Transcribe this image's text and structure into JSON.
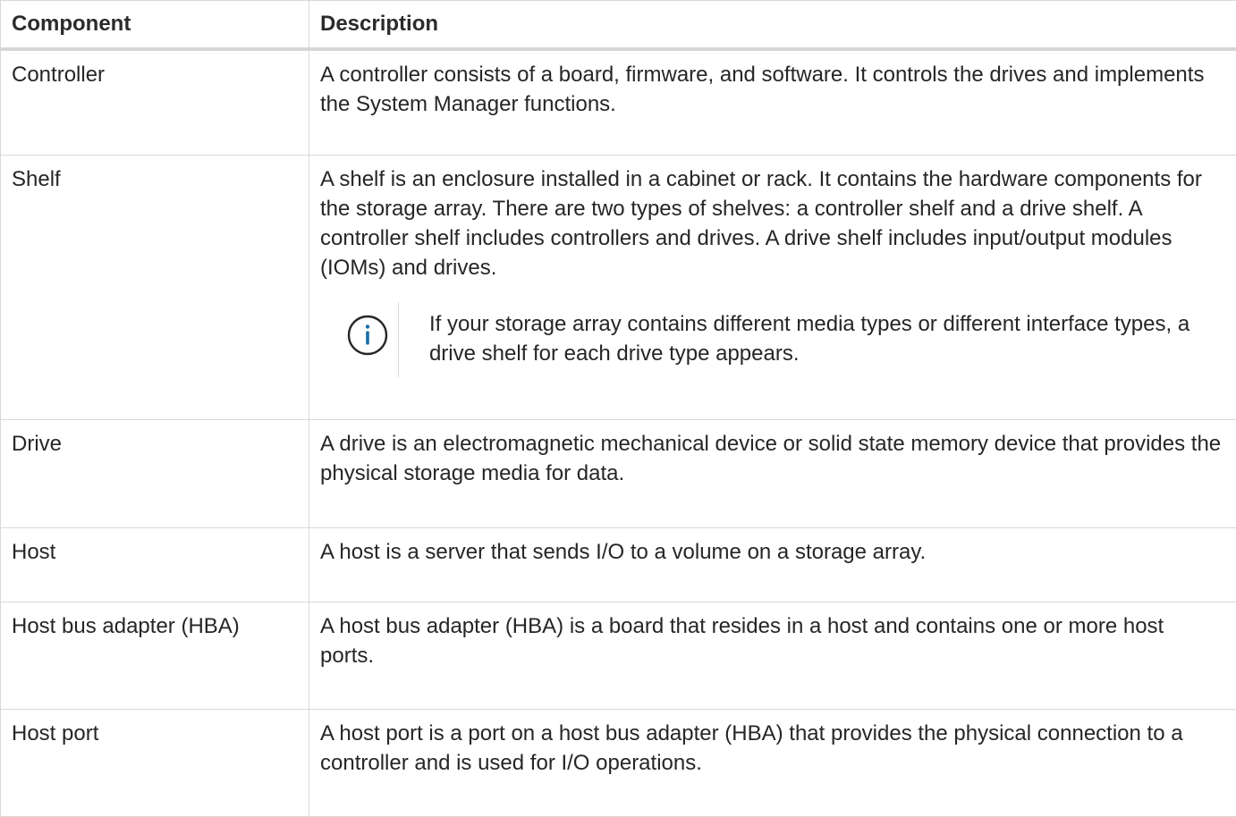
{
  "table": {
    "headers": {
      "component": "Component",
      "description": "Description"
    },
    "rows": [
      {
        "component": "Controller",
        "description": "A controller consists of a board, firmware, and software. It controls the drives and implements the System Manager functions."
      },
      {
        "component": "Shelf",
        "description": "A shelf is an enclosure installed in a cabinet or rack. It contains the hardware components for the storage array. There are two types of shelves: a controller shelf and a drive shelf. A controller shelf includes controllers and drives. A drive shelf includes input/output modules (IOMs) and drives.",
        "note": {
          "icon": "info-icon",
          "text": "If your storage array contains different media types or different interface types, a drive shelf for each drive type appears."
        }
      },
      {
        "component": "Drive",
        "description": "A drive is an electromagnetic mechanical device or solid state memory device that provides the physical storage media for data."
      },
      {
        "component": "Host",
        "description": "A host is a server that sends I/O to a volume on a storage array."
      },
      {
        "component": "Host bus adapter (HBA)",
        "description": "A host bus adapter (HBA) is a board that resides in a host and contains one or more host ports."
      },
      {
        "component": "Host port",
        "description": "A host port is a port on a host bus adapter (HBA) that provides the physical connection to a controller and is used for I/O operations."
      }
    ]
  },
  "colors": {
    "text": "#262626",
    "border": "#d9d9d9",
    "info_icon": "#1a6fa8"
  }
}
